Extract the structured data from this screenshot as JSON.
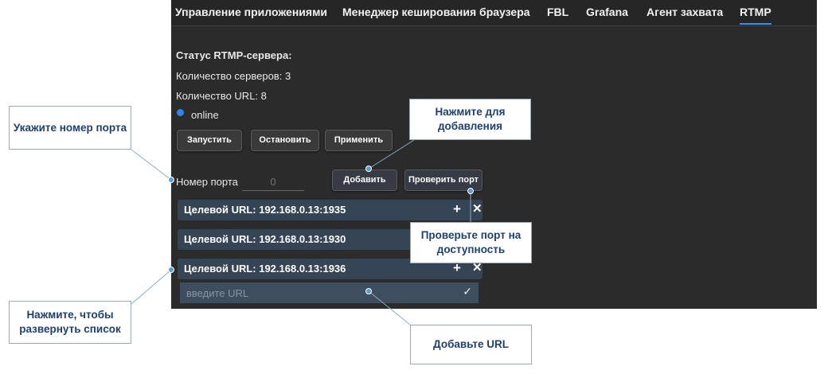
{
  "tabs": [
    {
      "label": "Управление приложениями"
    },
    {
      "label": "Менеджер кеширования браузера"
    },
    {
      "label": "FBL"
    },
    {
      "label": "Grafana"
    },
    {
      "label": "Агент захвата"
    },
    {
      "label": "RTMP"
    }
  ],
  "active_tab": "RTMP",
  "status": {
    "title": "Статус RTMP-сервера:",
    "servers": "Количество серверов: 3",
    "urls": "Количество URL: 8",
    "state": "online",
    "state_color": "#2f86ea"
  },
  "buttons": {
    "start": "Запустить",
    "stop": "Остановить",
    "apply": "Применить",
    "add": "Добавить",
    "check_port": "Проверить порт"
  },
  "port": {
    "label": "Номер порта",
    "value": "",
    "placeholder": "0"
  },
  "targets": [
    {
      "label": "Целевой URL: 192.168.0.13:1935"
    },
    {
      "label": "Целевой URL: 192.168.0.13:1930"
    },
    {
      "label": "Целевой URL: 192.168.0.13:1936"
    }
  ],
  "url_input": {
    "placeholder": "введите URL",
    "value": ""
  },
  "icons": {
    "add": "plus-icon",
    "remove": "close-icon",
    "confirm": "check-icon",
    "status": "status-dot-icon"
  },
  "callouts": {
    "port": "Укажите номер порта",
    "add": "Нажмите для добавления",
    "check": "Проверьте порт на доступность",
    "expand": "Нажмите, чтобы развернуть список",
    "url": "Добавьте URL"
  },
  "colors": {
    "background": "#2b2b2b",
    "accent": "#3a8de0",
    "row": "#354555",
    "callout_text": "#1f3f6e",
    "callout_border": "#9aa7b7",
    "connector": "#5b9bd5"
  }
}
